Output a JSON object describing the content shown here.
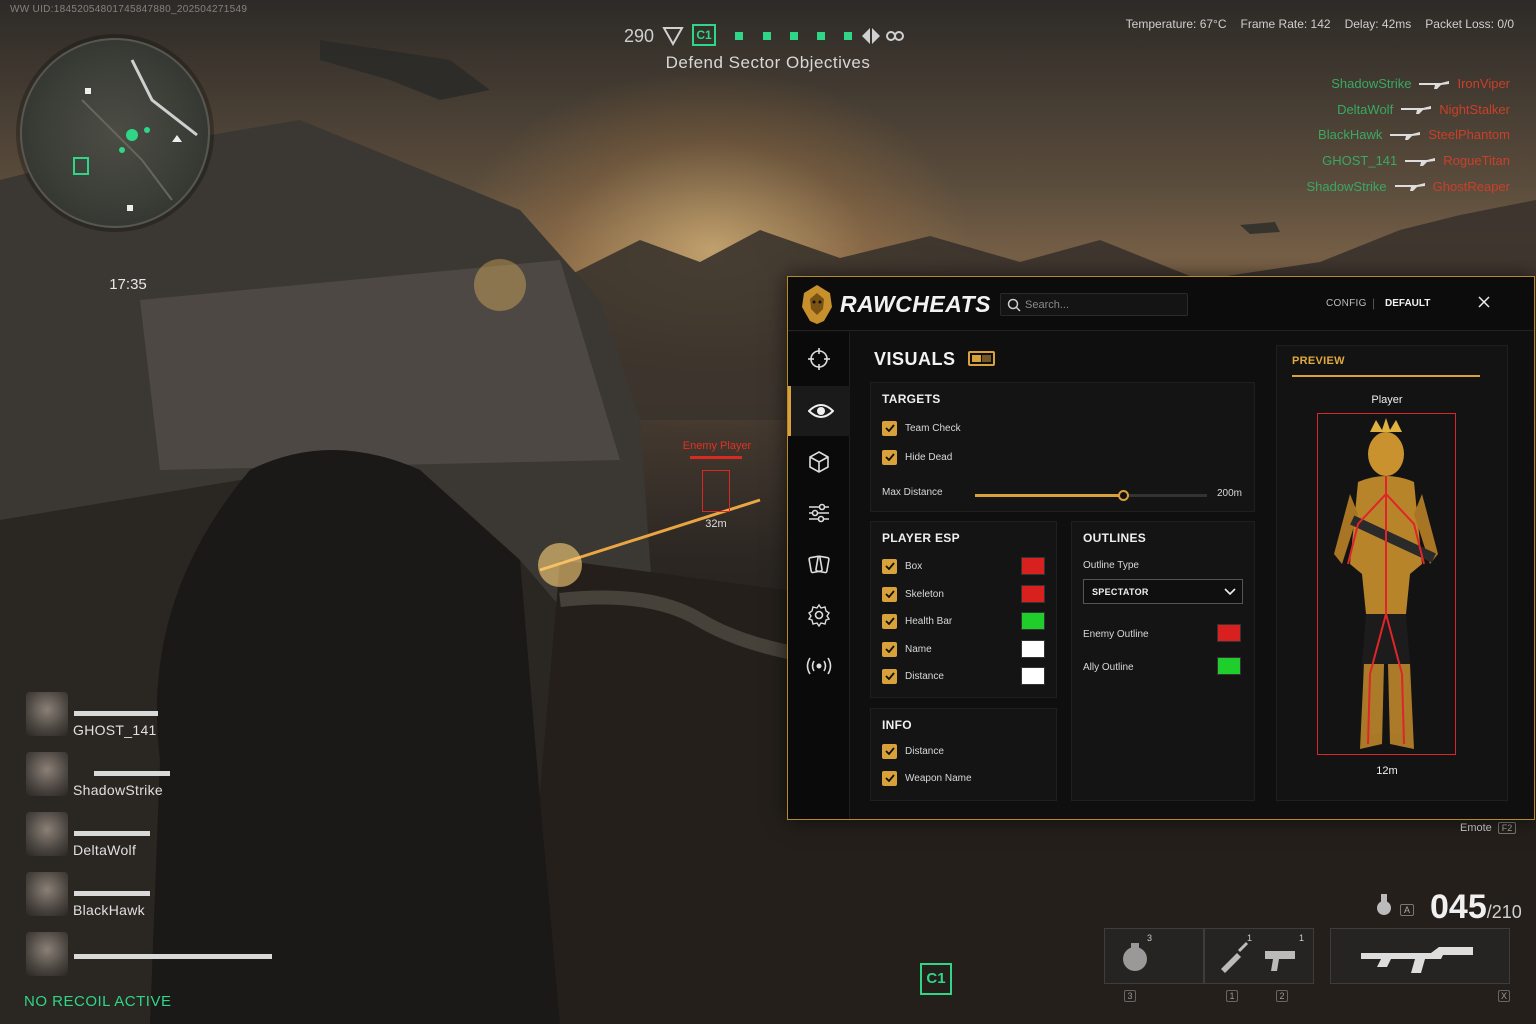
{
  "hud": {
    "uid": "WW UID:18452054801745847880_202504271549",
    "minimap_time": "17:35",
    "score": "290",
    "objective_badge": "C1",
    "objective_text": "Defend Sector Objectives",
    "stats": {
      "temperature": "Temperature: 67°C",
      "frame_rate": "Frame Rate: 142",
      "delay": "Delay: 42ms",
      "packet_loss": "Packet Loss: 0/0"
    },
    "killfeed": [
      {
        "killer": "ShadowStrike",
        "victim": "IronViper"
      },
      {
        "killer": "DeltaWolf",
        "victim": "NightStalker"
      },
      {
        "killer": "BlackHawk",
        "victim": "SteelPhantom"
      },
      {
        "killer": "GHOST_141",
        "victim": "RogueTitan"
      },
      {
        "killer": "ShadowStrike",
        "victim": "GhostReaper"
      }
    ],
    "enemy_marker": {
      "label": "Enemy Player",
      "distance": "32m"
    },
    "squad": [
      {
        "name": "GHOST_141"
      },
      {
        "name": "ShadowStrike"
      },
      {
        "name": "DeltaWolf"
      },
      {
        "name": "BlackHawk"
      },
      {
        "name": ""
      }
    ],
    "recoil_status": "NO RECOIL ACTIVE",
    "bottom_badge": "C1",
    "emote": {
      "label": "Emote",
      "key": "F2"
    },
    "ammo": {
      "mag": "045",
      "reserve": "/210",
      "fire_mode": "A"
    },
    "slots": [
      {
        "count": "3",
        "key": "3"
      },
      {
        "count": "1",
        "key": "1"
      },
      {
        "count": "1",
        "key": "2"
      },
      {
        "key": "X"
      }
    ]
  },
  "panel": {
    "brand": "RAWCHEATS",
    "search_placeholder": "Search...",
    "config_label": "CONFIG",
    "config_value": "DEFAULT",
    "sidebar": [
      {
        "icon": "crosshair-icon"
      },
      {
        "icon": "eye-icon",
        "active": true
      },
      {
        "icon": "cube-icon"
      },
      {
        "icon": "sliders-icon"
      },
      {
        "icon": "cards-icon"
      },
      {
        "icon": "gear-icon"
      },
      {
        "icon": "broadcast-icon"
      }
    ],
    "section_title": "VISUALS",
    "targets": {
      "title": "TARGETS",
      "team_check": "Team Check",
      "hide_dead": "Hide Dead",
      "max_distance_label": "Max Distance",
      "max_distance_value": "200m",
      "max_distance_fraction": 0.64
    },
    "player_esp": {
      "title": "PLAYER ESP",
      "items": [
        {
          "label": "Box",
          "color": "#d8201e"
        },
        {
          "label": "Skeleton",
          "color": "#d8201e"
        },
        {
          "label": "Health Bar",
          "color": "#1fce2a"
        },
        {
          "label": "Name",
          "color": "#ffffff"
        },
        {
          "label": "Distance",
          "color": "#ffffff"
        }
      ]
    },
    "outlines": {
      "title": "OUTLINES",
      "type_label": "Outline Type",
      "type_value": "SPECTATOR",
      "enemy_label": "Enemy Outline",
      "enemy_color": "#d8201e",
      "ally_label": "Ally Outline",
      "ally_color": "#1fce2a"
    },
    "info": {
      "title": "INFO",
      "distance": "Distance",
      "weapon_name": "Weapon Name"
    },
    "preview": {
      "title": "PREVIEW",
      "player_label": "Player",
      "distance": "12m"
    },
    "accent": "#d9a13a"
  }
}
